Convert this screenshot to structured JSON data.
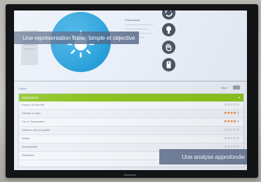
{
  "captions": {
    "top": "Une représentation fidèle, simple et objective",
    "bottom": "Une analyse approfondie"
  },
  "top_panel": {
    "label": "Provenance",
    "icons": [
      "sync-icon",
      "lightbulb-icon",
      "hand-icon",
      "tag-icon"
    ]
  },
  "ranking": {
    "title": "Critère",
    "controls": "Filtre",
    "header": "Classement",
    "header_arrow": "▾",
    "rows": [
      {
        "label": "Enjeux du marché",
        "stars": 0
      },
      {
        "label": "Attitude & suivi",
        "stars": 4
      },
      {
        "label": "Prix & Transaction",
        "stars": 4
      },
      {
        "label": "Attentes vers la qualité",
        "stars": 0
      },
      {
        "label": "Délais",
        "stars": 0
      },
      {
        "label": "Accessibilité",
        "stars": 0
      },
      {
        "label": "Réactivité",
        "stars": 0
      }
    ],
    "max_stars": 5
  },
  "colors": {
    "accent_green": "#8cc21f",
    "star_on": "#e8731d",
    "star_off": "#c2c8d3",
    "sun_blue": "#1f9ad6"
  }
}
